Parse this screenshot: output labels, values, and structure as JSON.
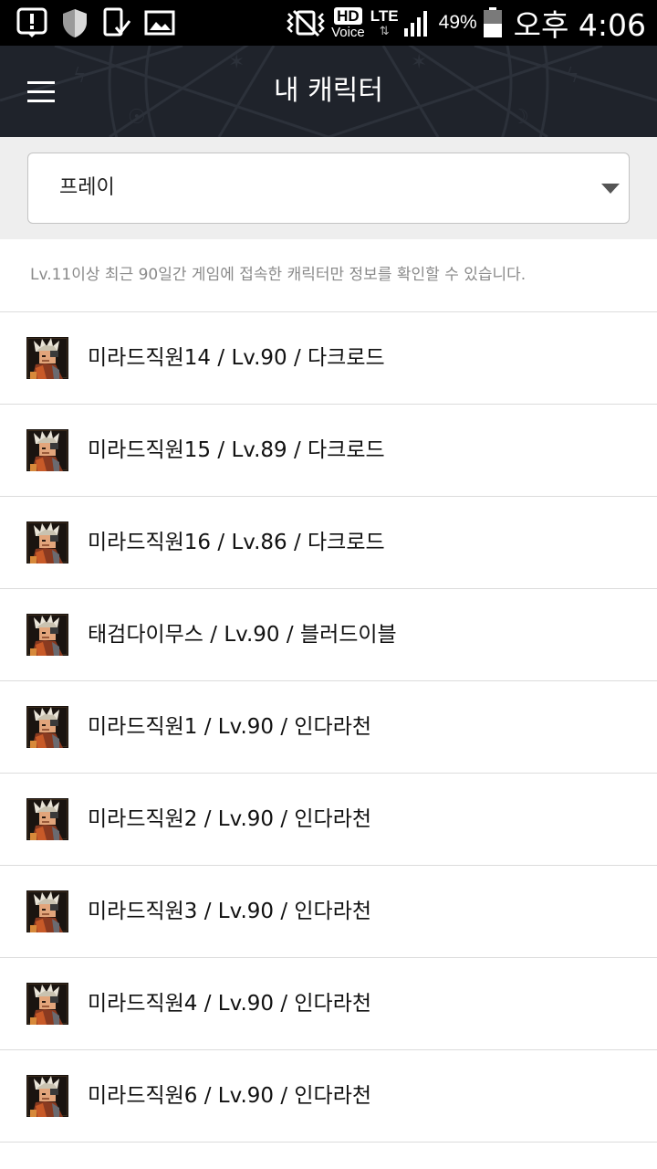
{
  "status_bar": {
    "clock": "오후 4:06",
    "battery_percent": "49%",
    "hd_label": "HD",
    "voice_label": "Voice",
    "network_label": "LTE",
    "icons": [
      "alert-icon",
      "shield-icon",
      "phone-check-icon",
      "image-icon",
      "vibrate-icon",
      "signal-icon",
      "battery-icon"
    ]
  },
  "header": {
    "title": "내 캐릭터",
    "menu_icon": "hamburger-menu-icon",
    "background_color": "#1f232b"
  },
  "server_select": {
    "selected": "프레이"
  },
  "notice": {
    "text": "Lv.11이상 최근 90일간 게임에 접속한 캐릭터만 정보를 확인할 수 있습니다."
  },
  "characters": [
    {
      "label": "미라드직원14 / Lv.90 / 다크로드"
    },
    {
      "label": "미라드직원15 / Lv.89 / 다크로드"
    },
    {
      "label": "미라드직원16 / Lv.86 / 다크로드"
    },
    {
      "label": "태검다이무스 / Lv.90 / 블러드이블"
    },
    {
      "label": "미라드직원1 / Lv.90 / 인다라천"
    },
    {
      "label": "미라드직원2 / Lv.90 / 인다라천"
    },
    {
      "label": "미라드직원3 / Lv.90 / 인다라천"
    },
    {
      "label": "미라드직원4 / Lv.90 / 인다라천"
    },
    {
      "label": "미라드직원6 / Lv.90 / 인다라천"
    }
  ]
}
